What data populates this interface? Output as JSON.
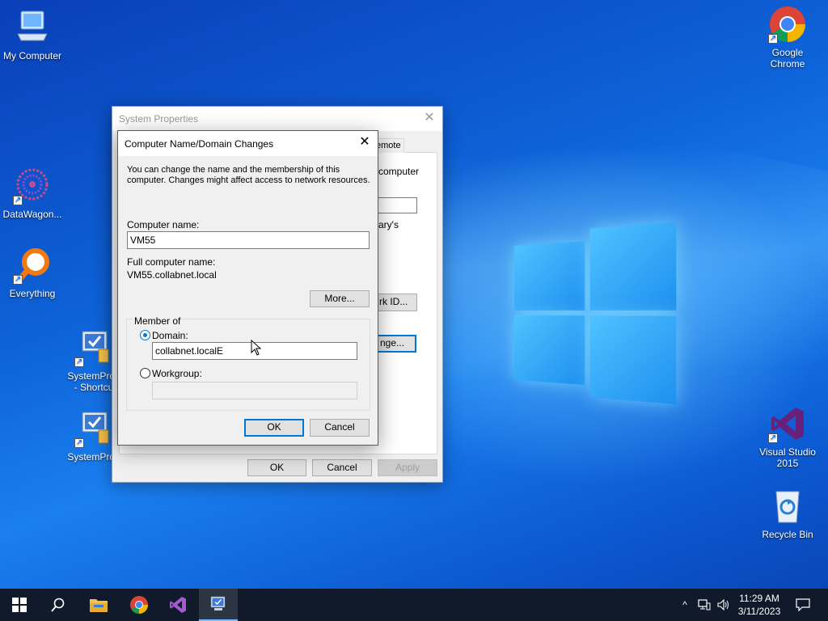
{
  "desktop": {
    "icons": {
      "my_computer": "My Computer",
      "datawagon": "DataWagon...",
      "everything": "Everything",
      "sysprop1_line1": "SystemProp",
      "sysprop1_line2": "- Shortcu",
      "sysprop2": "SystemProp",
      "chrome_line1": "Google",
      "chrome_line2": "Chrome",
      "vs_line1": "Visual Studio",
      "vs_line2": "2015",
      "recycle": "Recycle Bin"
    }
  },
  "system_properties": {
    "title": "System Properties",
    "tab_remote": "emote",
    "text_computer": "computer",
    "text_ary": "ary's",
    "network_id_button": "rk ID...",
    "change_button": "nge...",
    "ok_label": "OK",
    "cancel_label": "Cancel",
    "apply_label": "Apply"
  },
  "dialog": {
    "title": "Computer Name/Domain Changes",
    "description_line1": "You can change the name and the membership of this",
    "description_line2": "computer. Changes might affect access to network resources.",
    "computer_name_label": "Computer name:",
    "computer_name_value": "VM55",
    "full_name_label": "Full computer name:",
    "full_name_value": "VM55.collabnet.local",
    "more_label": "More...",
    "member_of_label": "Member of",
    "domain_label": "Domain:",
    "domain_value": "collabnet.localE",
    "workgroup_label": "Workgroup:",
    "workgroup_value": "",
    "ok_label": "OK",
    "cancel_label": "Cancel",
    "selected_membership": "domain"
  },
  "taskbar": {
    "items": [
      "start-icon",
      "search-icon",
      "file-explorer-icon",
      "chrome-icon",
      "visual-studio-icon",
      "system-properties-icon"
    ],
    "active_item": "system-properties-icon",
    "time": "11:29 AM",
    "date": "3/11/2023"
  },
  "colors": {
    "accent": "#0078d7",
    "taskbar": "#101a2a",
    "wallpaper": "#0e63d8"
  }
}
